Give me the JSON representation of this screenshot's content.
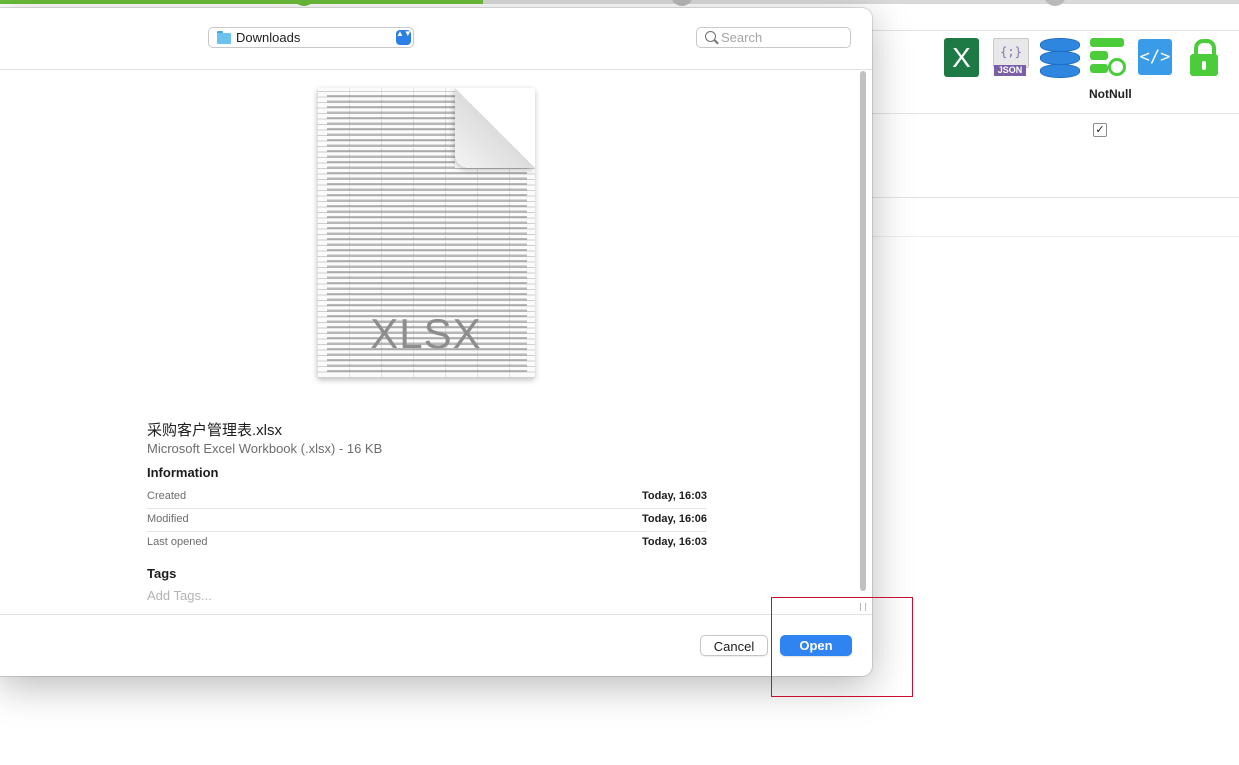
{
  "background_app": {
    "progress_fraction": 0.39,
    "column_header": "NotNull",
    "checkbox_checked": true,
    "toolbar_icons": [
      "excel-icon",
      "json-icon",
      "database-icon",
      "server-sync-icon",
      "code-icon",
      "unlock-icon"
    ],
    "excel_glyph": "X",
    "json_glyph": "{;}",
    "json_tag": "JSON",
    "code_glyph": "</>",
    "checkbox_glyph": "✓"
  },
  "dialog": {
    "location": "Downloads",
    "location_stepper": "▲▼",
    "search_placeholder": "Search",
    "preview": {
      "file_type_label": "XLSX",
      "file_name": "采购客户管理表.xlsx",
      "file_kind": "Microsoft Excel Workbook (.xlsx) - 16 KB"
    },
    "info": {
      "heading": "Information",
      "rows": [
        {
          "label": "Created",
          "value": "Today, 16:03"
        },
        {
          "label": "Modified",
          "value": "Today, 16:06"
        },
        {
          "label": "Last opened",
          "value": "Today, 16:03"
        }
      ]
    },
    "tags": {
      "heading": "Tags",
      "placeholder": "Add Tags..."
    },
    "buttons": {
      "cancel": "Cancel",
      "open": "Open"
    }
  },
  "colors": {
    "accent": "#2f84f2",
    "highlight": "#c8102e",
    "progress": "#6bbd3a",
    "excel": "#1d7a45"
  }
}
